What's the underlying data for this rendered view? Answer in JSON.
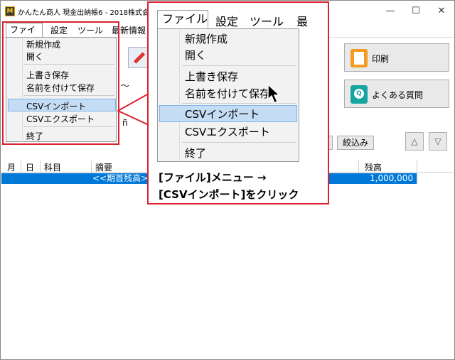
{
  "window": {
    "title": "かんたん商人 現金出納帳6 - 2018株式会社ア",
    "app_icon_text": "M",
    "controls": {
      "minimize": "—",
      "maximize": "☐",
      "close": "✕"
    }
  },
  "menubar": {
    "items": [
      {
        "label": "ファイル"
      },
      {
        "label": "設定"
      },
      {
        "label": "ツール"
      },
      {
        "label": "最新情報"
      }
    ]
  },
  "file_menu": {
    "items": [
      {
        "label": "新規作成"
      },
      {
        "label": "開く"
      },
      {
        "label": "上書き保存"
      },
      {
        "label": "名前を付けて保存"
      },
      {
        "label": "CSVインポート",
        "highlighted": true
      },
      {
        "label": "CSVエクスポート"
      },
      {
        "label": "終了"
      }
    ]
  },
  "zoom": {
    "menubar": [
      "ファイル",
      "設定",
      "ツール",
      "最"
    ],
    "caption_line1": "[ファイル]メニュー →",
    "caption_line2": "[CSVインポート]をクリック"
  },
  "toolbar": {
    "print_label": "印刷",
    "faq_label": "よくある質問",
    "filter_label": "絞込み",
    "up_arrow": "△",
    "down_arrow": "▽",
    "snippet_tilde": "～",
    "snippet_chars": "ñ"
  },
  "table": {
    "headers": {
      "month": "月",
      "day": "日",
      "account": "科目",
      "summary": "摘要",
      "balance": "残高"
    },
    "rows": [
      {
        "summary": "<<期首残高>>",
        "balance": "1,000,000",
        "selected": true
      }
    ]
  },
  "colors": {
    "highlight_red": "#d9232e",
    "selection_blue": "#0078d7",
    "menu_hover": "#c5ddf4"
  }
}
